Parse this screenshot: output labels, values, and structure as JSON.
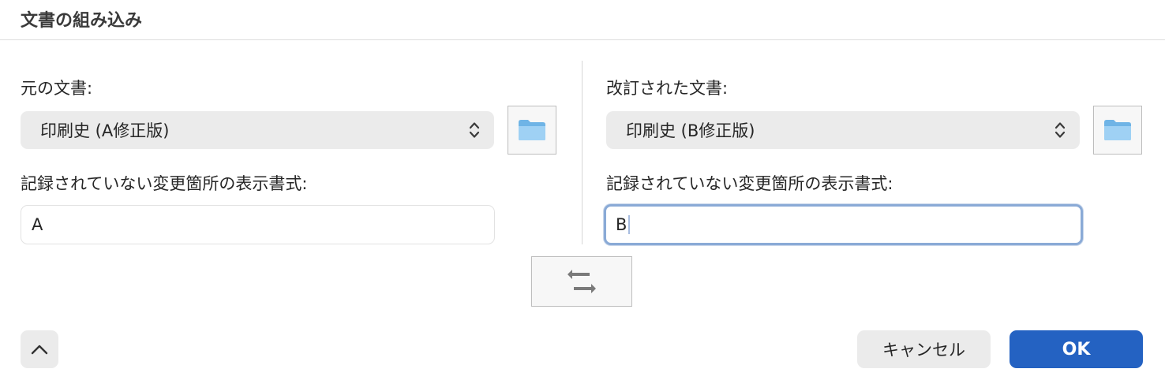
{
  "dialog": {
    "title": "文書の組み込み"
  },
  "original": {
    "label": "元の文書:",
    "selected_document": "印刷史 (A修正版)",
    "format_label": "記録されていない変更箇所の表示書式:",
    "format_value": "A"
  },
  "revised": {
    "label": "改訂された文書:",
    "selected_document": "印刷史 (B修正版)",
    "format_label": "記録されていない変更箇所の表示書式:",
    "format_value": "B"
  },
  "icons": {
    "folder": "folder-icon",
    "select_arrows": "chevron-up-down-icon",
    "swap": "swap-arrows-icon",
    "disclosure": "chevron-up-icon"
  },
  "buttons": {
    "cancel_label": "キャンセル",
    "ok_label": "OK"
  },
  "colors": {
    "accent": "#2462c2",
    "focus_ring": "#8aaad6",
    "control_background": "#ebebeb"
  }
}
